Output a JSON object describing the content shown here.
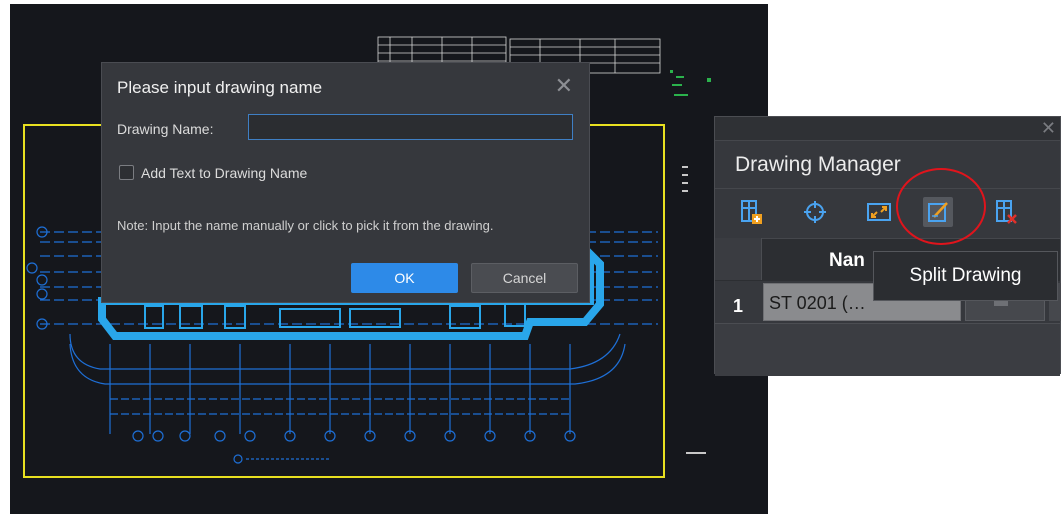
{
  "dialog": {
    "title": "Please input drawing name",
    "close_symbol": "✕",
    "drawing_name_label": "Drawing Name:",
    "drawing_name_value": "",
    "add_text_checked": false,
    "add_text_label": "Add Text to Drawing Name",
    "note": "Note: Input the name manually or click to pick it from the drawing.",
    "ok_label": "OK",
    "cancel_label": "Cancel"
  },
  "drawing_manager": {
    "title": "Drawing Manager",
    "close_symbol": "✕",
    "toolbar": [
      {
        "icon": "add-drawing-icon"
      },
      {
        "icon": "locate-icon"
      },
      {
        "icon": "fit-drawing-icon"
      },
      {
        "icon": "split-drawing-icon",
        "active": true
      },
      {
        "icon": "delete-drawing-icon"
      }
    ],
    "column_header": "Nan",
    "rows": [
      {
        "number": "1",
        "name": "ST 0201 (…"
      }
    ],
    "tooltip": "Split Drawing"
  },
  "colors": {
    "canvas_bg": "#15171c",
    "cad_lines": "#1e6fd6",
    "frame": "#e8e020",
    "dialog_bg": "#36383d",
    "accent": "#2d8ae8",
    "highlight_circle": "#e0141c"
  }
}
